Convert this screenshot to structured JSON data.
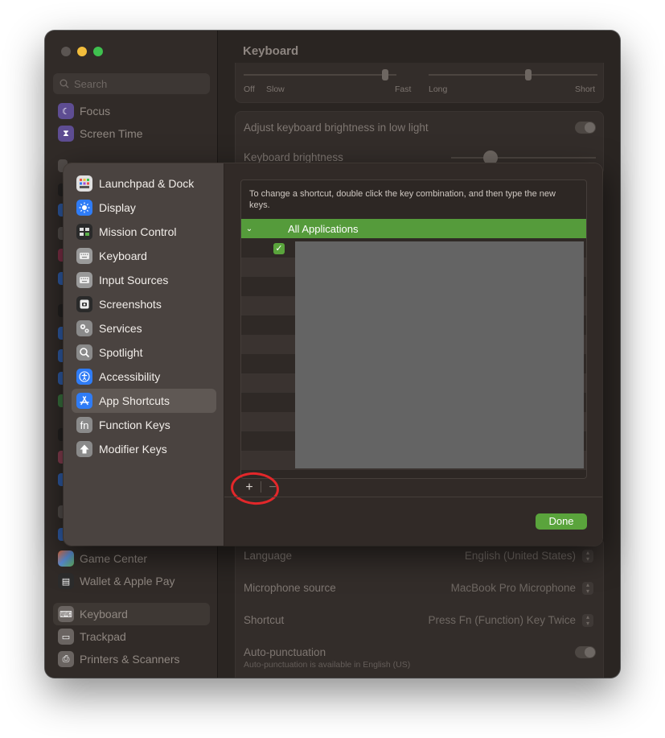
{
  "window": {
    "title": "Keyboard",
    "search_placeholder": "Search",
    "sidebar_top": [
      {
        "label": "Focus",
        "icon": "moon-icon",
        "color": "#5e4d92"
      },
      {
        "label": "Screen Time",
        "icon": "hourglass-icon",
        "color": "#5e4d92"
      }
    ],
    "sidebar_bottom": [
      {
        "label": "Game Center",
        "icon": "game-center-icon",
        "color": "#c46d3a"
      },
      {
        "label": "Wallet & Apple Pay",
        "icon": "wallet-icon",
        "color": "#2c2c2c"
      },
      {
        "label": "Keyboard",
        "icon": "keyboard-icon",
        "color": "#6a6461",
        "selected": true
      },
      {
        "label": "Trackpad",
        "icon": "trackpad-icon",
        "color": "#6a6461"
      },
      {
        "label": "Printers & Scanners",
        "icon": "printer-icon",
        "color": "#6a6461"
      }
    ],
    "repeat": {
      "left_labels": [
        "Off",
        "Slow"
      ],
      "mid_label": "Fast",
      "delay_labels": [
        "Long"
      ],
      "right_label": "Short"
    },
    "brightness_low_light_label": "Adjust keyboard brightness in low light",
    "brightness_label": "Keyboard brightness",
    "dictation": {
      "language_label": "Language",
      "language_value": "English (United States)",
      "mic_label": "Microphone source",
      "mic_value": "MacBook Pro Microphone",
      "shortcut_label": "Shortcut",
      "shortcut_value": "Press Fn (Function) Key Twice",
      "autopunct_label": "Auto-punctuation",
      "autopunct_sub": "Auto-punctuation is available in English (US)"
    }
  },
  "modal": {
    "items": [
      {
        "label": "Launchpad & Dock",
        "icon": "launchpad-icon",
        "color": "#e0e0e0"
      },
      {
        "label": "Display",
        "icon": "sun-icon",
        "color": "#2f7cf6"
      },
      {
        "label": "Mission Control",
        "icon": "mission-control-icon",
        "color": "#2a2a2a"
      },
      {
        "label": "Keyboard",
        "icon": "keyboard-icon",
        "color": "#9a9a9a"
      },
      {
        "label": "Input Sources",
        "icon": "keyboard-icon",
        "color": "#9a9a9a"
      },
      {
        "label": "Screenshots",
        "icon": "screenshot-icon",
        "color": "#2a2a2a"
      },
      {
        "label": "Services",
        "icon": "gears-icon",
        "color": "#8a8a8a"
      },
      {
        "label": "Spotlight",
        "icon": "magnifier-icon",
        "color": "#8a8a8a"
      },
      {
        "label": "Accessibility",
        "icon": "accessibility-icon",
        "color": "#2f7cf6"
      },
      {
        "label": "App Shortcuts",
        "icon": "app-store-icon",
        "color": "#2f7cf6",
        "selected": true
      },
      {
        "label": "Function Keys",
        "icon": "fn-icon",
        "color": "#8a8a8a"
      },
      {
        "label": "Modifier Keys",
        "icon": "arrow-up-icon",
        "color": "#8a8a8a"
      }
    ],
    "instructions": "To change a shortcut, double click the key combination, and then type the new keys.",
    "group_label": "All Applications",
    "add_label": "+",
    "remove_label": "−",
    "done_label": "Done"
  }
}
